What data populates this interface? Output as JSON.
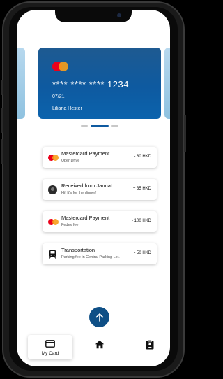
{
  "card": {
    "number": "**** **** **** 1234",
    "expiry": "07/21",
    "holder": "Liliana Hester",
    "brand_icon": "mastercard-logo"
  },
  "carousel": {
    "count": 3,
    "active_index": 1
  },
  "transactions": [
    {
      "icon": "mastercard-logo",
      "title": "Mastercard Payment",
      "subtitle": "Uber Drive",
      "amount": "- 80 HKD"
    },
    {
      "icon": "avatar",
      "title": "Received from Jannat",
      "subtitle": "Hi! It's for the dinner!",
      "amount": "+ 35 HKD"
    },
    {
      "icon": "mastercard-logo",
      "title": "Mastercard Payment",
      "subtitle": "Fedex fee.",
      "amount": "- 100 HKD"
    },
    {
      "icon": "train-icon",
      "title": "Transportation",
      "subtitle": "Parking fee in Central Parking Lot.",
      "amount": "- 50 HKD"
    }
  ],
  "fab": {
    "icon": "arrow-up-icon"
  },
  "nav": {
    "my_card_label": "My Card",
    "items": [
      {
        "icon": "credit-card-icon",
        "label": "My Card",
        "active": true
      },
      {
        "icon": "home-icon",
        "active": false
      },
      {
        "icon": "clipboard-user-icon",
        "active": false
      }
    ]
  },
  "colors": {
    "primary": "#0e5aa0",
    "fab": "#0e4f86",
    "mc_red": "#eb001b",
    "mc_orange": "#f79e1b"
  }
}
